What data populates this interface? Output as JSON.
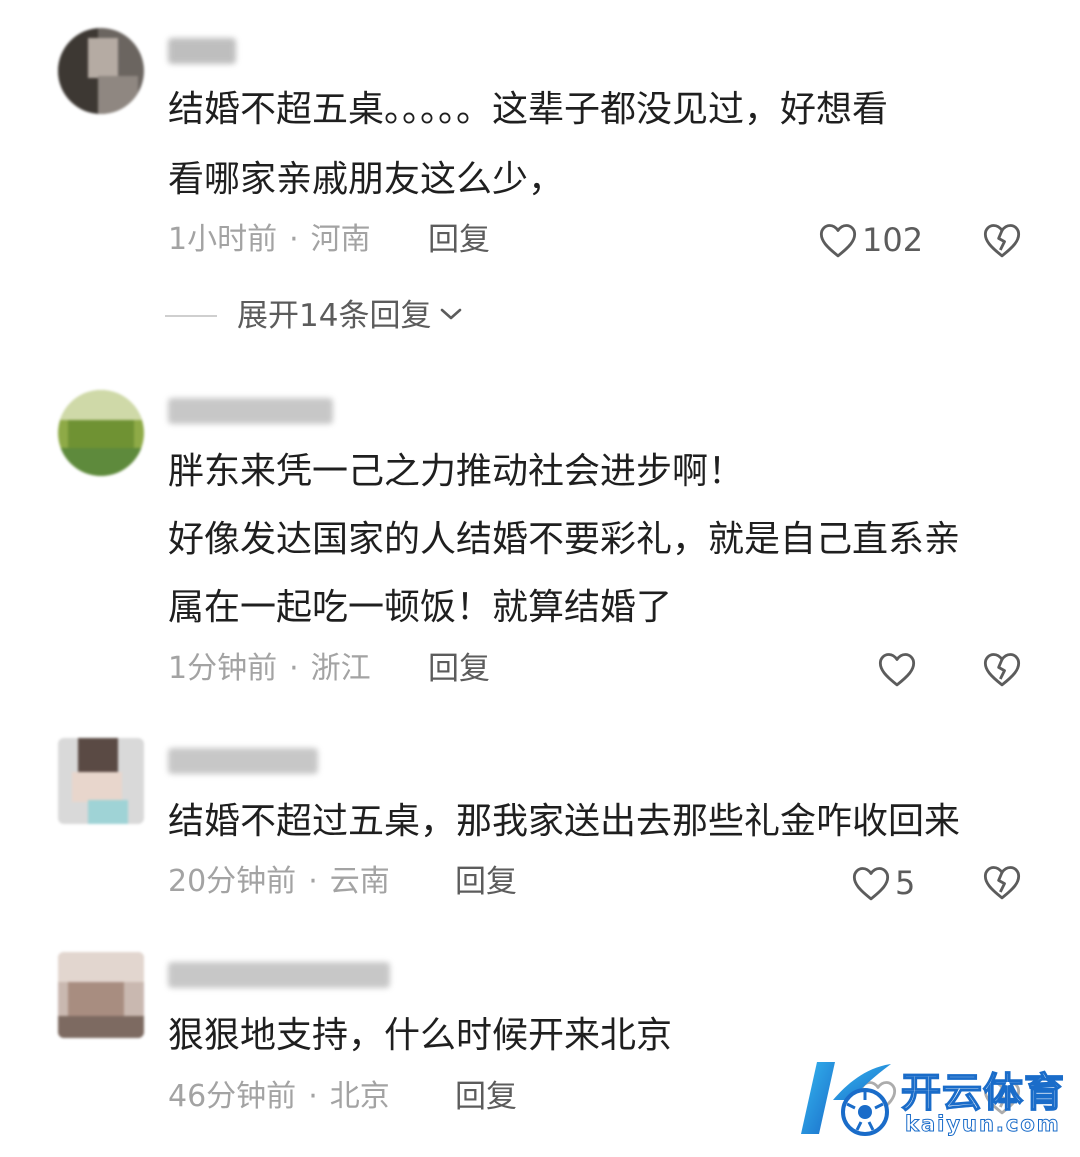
{
  "comments": [
    {
      "lines": [
        "结婚不超五桌。。。。。这辈子都没见过，好想看",
        "看哪家亲戚朋友这么少，"
      ],
      "meta_time": "1小时前",
      "meta_sep": "·",
      "meta_location": "河南",
      "reply_label": "回复",
      "like_count": "102",
      "expand_label": "展开14条回复"
    },
    {
      "lines": [
        "胖东来凭一己之力推动社会进步啊！",
        "好像发达国家的人结婚不要彩礼，就是自己直系亲",
        "属在一起吃一顿饭！就算结婚了"
      ],
      "meta_time": "1分钟前",
      "meta_sep": "·",
      "meta_location": "浙江",
      "reply_label": "回复",
      "like_count": ""
    },
    {
      "lines": [
        "结婚不超过五桌，那我家送出去那些礼金咋收回来"
      ],
      "meta_time": "20分钟前",
      "meta_sep": "·",
      "meta_location": "云南",
      "reply_label": "回复",
      "like_count": "5"
    },
    {
      "lines": [
        "狠狠地支持，什么时候开来北京"
      ],
      "meta_time": "46分钟前",
      "meta_sep": "·",
      "meta_location": "北京",
      "reply_label": "回复",
      "like_count": ""
    }
  ],
  "icons": {
    "like": "heart-outline-icon",
    "dislike": "broken-heart-icon",
    "expand": "chevron-down-icon"
  },
  "watermark": {
    "title": "开云体育",
    "url": "kaiyun.com",
    "colors": {
      "primary": "#1a6cc9",
      "accent": "#35b8f0"
    }
  },
  "colors": {
    "text": "#1f1f1f",
    "meta": "#a3a3a3",
    "action": "#5c5c5c"
  }
}
